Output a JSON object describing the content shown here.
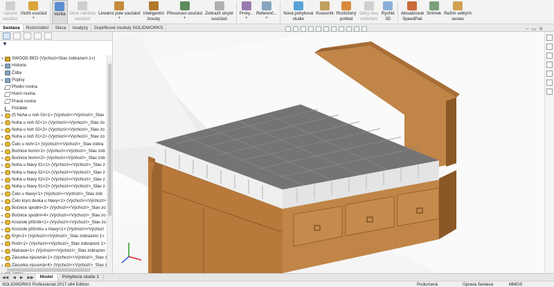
{
  "ribbon": {
    "buttons": [
      {
        "label": "Upravit\nsoučást",
        "disabled": true,
        "icon": "edit-part-icon"
      },
      {
        "label": "Vložit součást",
        "disabled": false,
        "caret": true,
        "icon": "insert-component-icon"
      },
      {
        "label": "Vazba",
        "disabled": false,
        "active": true,
        "icon": "mate-icon"
      },
      {
        "label": "Okno náhledu\nsoučásti",
        "disabled": true,
        "icon": "preview-window-icon"
      },
      {
        "label": "Lineární pole součástí",
        "disabled": false,
        "caret": true,
        "icon": "linear-pattern-icon"
      },
      {
        "label": "Inteligentní\nšrouby",
        "disabled": false,
        "icon": "smart-fasteners-icon"
      },
      {
        "label": "Přesunout součást",
        "disabled": false,
        "caret": true,
        "icon": "move-component-icon"
      },
      {
        "label": "Zobrazit skryté\nsoučásti",
        "disabled": false,
        "icon": "show-hidden-icon"
      },
      {
        "label": "Prvky...",
        "disabled": false,
        "caret": true,
        "icon": "features-icon"
      },
      {
        "label": "Referenč...",
        "disabled": false,
        "caret": true,
        "icon": "reference-geometry-icon"
      },
      {
        "label": "Nová pohybová\nstudie",
        "disabled": false,
        "icon": "motion-study-icon"
      },
      {
        "label": "Kusovník",
        "disabled": false,
        "icon": "bom-icon"
      },
      {
        "label": "Rozložený\npohled",
        "disabled": false,
        "icon": "exploded-view-icon"
      },
      {
        "label": "Skicy čáry\nrozložení",
        "disabled": true,
        "icon": "explode-line-icon"
      },
      {
        "label": "Rychlé\n3D",
        "disabled": false,
        "icon": "instant3d-icon"
      },
      {
        "label": "Aktualizovat\nSpeedPak",
        "disabled": false,
        "icon": "speedpak-icon"
      },
      {
        "label": "Snímek",
        "disabled": false,
        "icon": "snapshot-icon"
      },
      {
        "label": "Režim velkých\nsestav",
        "disabled": false,
        "icon": "large-assembly-icon"
      }
    ]
  },
  "command_tabs": [
    "Sestava",
    "Rozmístění",
    "Skica",
    "Analýzy",
    "Doplňkové moduly SOLIDWORKS"
  ],
  "tree": {
    "root": "SWOOD BED  (Výchozí<Stav zobrazení-1>)",
    "items": [
      {
        "label": "Historie",
        "icon": "folder",
        "arrow": "▸"
      },
      {
        "label": "Čidla",
        "icon": "folder",
        "arrow": ""
      },
      {
        "label": "Popisy",
        "icon": "folder",
        "arrow": "▸"
      },
      {
        "label": "Přední rovina",
        "icon": "plane",
        "arrow": ""
      },
      {
        "label": "Horní rovina",
        "icon": "plane",
        "arrow": ""
      },
      {
        "label": "Pravá rovina",
        "icon": "plane",
        "arrow": ""
      },
      {
        "label": "Počátek",
        "icon": "origin",
        "arrow": ""
      },
      {
        "label": "(f) Noha u noh 01<1> (Výchozí<<Výchozí>_Stav",
        "icon": "part",
        "arrow": "▸"
      },
      {
        "label": "Noha u noh 02<1> (Výchozí<<Výchozí>_Stav zo",
        "icon": "part",
        "arrow": "▸"
      },
      {
        "label": "Noha u noh 02<2> (Výchozí<<Výchozí>_Stav zo",
        "icon": "part",
        "arrow": "▸"
      },
      {
        "label": "Noha u noh 01<2> (Výchozí<<Výchozí>_Stav zo",
        "icon": "part",
        "arrow": "▸"
      },
      {
        "label": "Čelo u noh<1> (Výchozí<<Výchozí>_Stav zobra",
        "icon": "part",
        "arrow": "▸"
      },
      {
        "label": "Bočnice horní<1> (Výchozí<<Výchozí>_Stav zob",
        "icon": "part",
        "arrow": "▸"
      },
      {
        "label": "Bočnice horní<2> (Výchozí<<Výchozí>_Stav zob",
        "icon": "part",
        "arrow": "▸"
      },
      {
        "label": "Noha u hlavy 01<1> (Výchozí<<Výchozí>_Stav z",
        "icon": "part",
        "arrow": "▸"
      },
      {
        "label": "Noha u hlavy 02<1> (Výchozí<<Výchozí>_Stav z",
        "icon": "part",
        "arrow": "▸"
      },
      {
        "label": "Noha u hlavy 02<2> (Výchozí<<Výchozí>_Stav z",
        "icon": "part",
        "arrow": "▸"
      },
      {
        "label": "Noha u hlavy 01<2> (Výchozí<<Výchozí>_Stav z",
        "icon": "part",
        "arrow": "▸"
      },
      {
        "label": "Čelo u hlavy<1> (Výchozí<<Výchozí>_Stav zob",
        "icon": "part",
        "arrow": "▸"
      },
      {
        "label": "Čelo kryci deska u hlavy<1> (Výchozí<<Výchozí>",
        "icon": "part",
        "arrow": "▸"
      },
      {
        "label": "Bočnice spodní<3> (Výchozí<<Výchozí>_Stav zo",
        "icon": "part",
        "arrow": "▸"
      },
      {
        "label": "Bočnice spodní<4> (Výchozí<<Výchozí>_Stav zo",
        "icon": "part",
        "arrow": "▸"
      },
      {
        "label": "Konzole příčník<1> (Výchozí<<Výchozí>_Stav zo",
        "icon": "part",
        "arrow": "▸"
      },
      {
        "label": "Konzole příčníku u hlavy<1> (Výchozí<<Výchozí",
        "icon": "part",
        "arrow": "▸"
      },
      {
        "label": "Kryt<1> (Výchozí<<Výchozí>_Stav zobrazení 1>",
        "icon": "part",
        "arrow": "▸"
      },
      {
        "label": "Rošt<1> (Výchozí<<Výchozí>_Stav zobrazení 1>",
        "icon": "part",
        "arrow": "▸"
      },
      {
        "label": "Matrace<1> (Výchozí<<Výchozí>_Stav zobrazen",
        "icon": "part",
        "arrow": "▸"
      },
      {
        "label": "Zásuvka výsuvná<1> (Výchozí<<Výchozí>_Stav z",
        "icon": "part",
        "arrow": "▸"
      },
      {
        "label": "Zásuvka výsuvná<4> (Výchozí<<Výchozí>_Stav z",
        "icon": "part",
        "arrow": "▸"
      },
      {
        "label": "Vazby",
        "icon": "folder",
        "arrow": "▸"
      }
    ]
  },
  "bottom_tabs": [
    "Model",
    "Pohybová studie 1"
  ],
  "status": {
    "app": "SOLIDWORKS Professional 2017 x64 Edition",
    "state": "Podurčená",
    "mode": "Úprava Sestava",
    "units": "MMGS"
  },
  "colors": {
    "wood": "#b77a3c",
    "wood_dark": "#8a5826",
    "mattress_top": "#737373",
    "mattress_side": "#eeeeee",
    "accent": "#1f5ea8"
  }
}
